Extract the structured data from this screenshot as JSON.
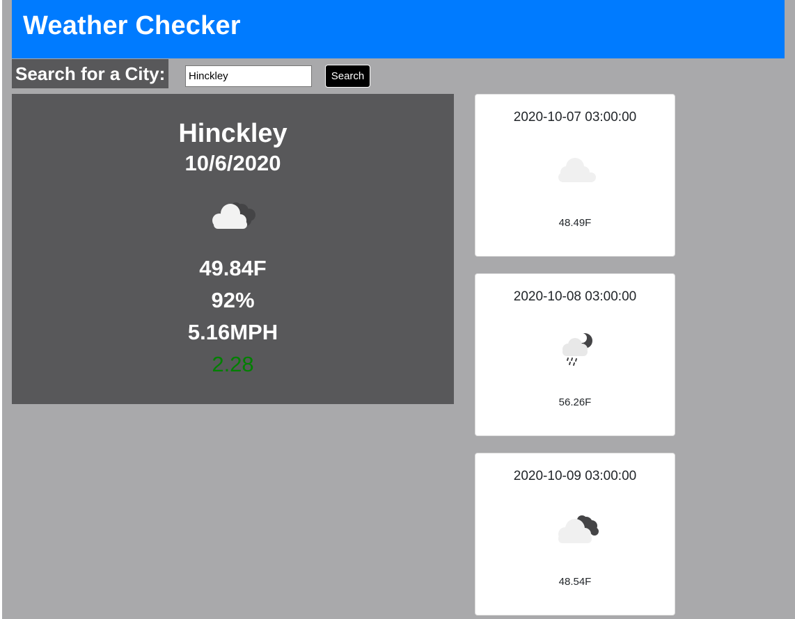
{
  "header": {
    "title": "Weather Checker"
  },
  "search": {
    "label": "Search for a City:",
    "value": "Hinckley",
    "button_label": "Search"
  },
  "current": {
    "city": "Hinckley",
    "date": "10/6/2020",
    "icon": "partly-cloudy-night-icon",
    "temp": "49.84F",
    "humidity": "92%",
    "wind": "5.16MPH",
    "uv": "2.28",
    "uv_color": "#008000"
  },
  "forecast": [
    {
      "date": "2020-10-07 03:00:00",
      "icon": "cloud-icon",
      "temp": "48.49F"
    },
    {
      "date": "2020-10-08 03:00:00",
      "icon": "rain-night-icon",
      "temp": "56.26F"
    },
    {
      "date": "2020-10-09 03:00:00",
      "icon": "broken-clouds-icon",
      "temp": "48.54F"
    }
  ],
  "colors": {
    "header": "#007bff",
    "background": "#a9a9ab",
    "panel": "#58585a"
  }
}
